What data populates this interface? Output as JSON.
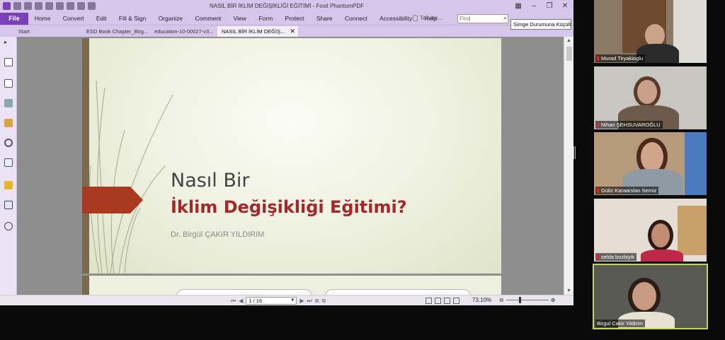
{
  "window": {
    "title": "NASIL BİR İKLİM DEĞİŞİKLİĞİ EĞİTİMİ - Foxit PhantomPDF",
    "tooltip": "Simge Durumuna Küçült"
  },
  "menu": {
    "file_label": "File",
    "items": [
      "Home",
      "Convert",
      "Edit",
      "Fill & Sign",
      "Organize",
      "Comment",
      "View",
      "Form",
      "Protect",
      "Share",
      "Connect",
      "Accessibility",
      "Help"
    ],
    "tell_me": "Tell me...",
    "find_placeholder": "Find"
  },
  "tabs": [
    {
      "label": "Start"
    },
    {
      "label": "ESD Book Chapter_Birg..."
    },
    {
      "label": "education-10-00027-v3..."
    },
    {
      "label": "NASIL BİR İKLİM DEĞİŞ..."
    }
  ],
  "slide": {
    "title_line1": "Nasıl Bir",
    "title_line2": "İklim Değişikliği Eğitimi?",
    "author": "Dr. Birgül ÇAKIR YILDIRIM"
  },
  "status": {
    "page_indicator": "1 / 16",
    "zoom": "73.10%"
  },
  "participants": [
    {
      "name": "Murad Tiryakioglu",
      "active": false
    },
    {
      "name": "Nihan ŞEHSUVAROĞLU",
      "active": false
    },
    {
      "name": "Güliz Karaarslan Semiz",
      "active": false
    },
    {
      "name": "selda bozbiyik",
      "active": false
    },
    {
      "name": "Birgul Cakir Yildirim",
      "active": true
    }
  ],
  "colors": {
    "accent_purple": "#7b3fb7",
    "slide_title_red": "#a4282a",
    "active_speaker_border": "#c2d94f"
  }
}
